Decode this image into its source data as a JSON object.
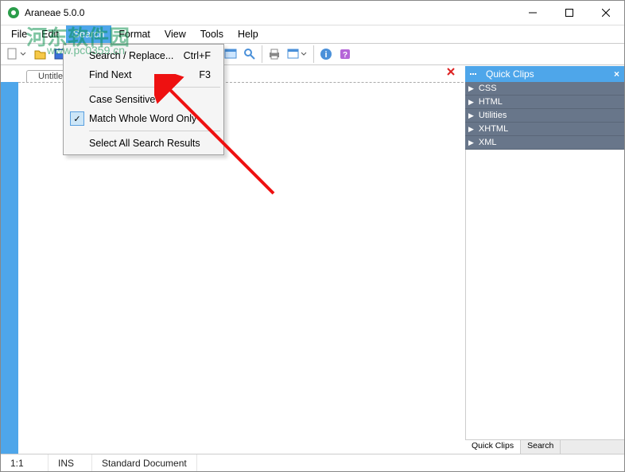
{
  "window": {
    "title": "Araneae 5.0.0"
  },
  "menubar": {
    "file": "File",
    "edit": "Edit",
    "search": "Search",
    "format": "Format",
    "view": "View",
    "tools": "Tools",
    "help": "Help"
  },
  "dropdown": {
    "search_replace": "Search / Replace...",
    "search_replace_key": "Ctrl+F",
    "find_next": "Find Next",
    "find_next_key": "F3",
    "case_sensitive": "Case Sensitive",
    "match_whole": "Match Whole Word Only",
    "select_all": "Select All Search Results"
  },
  "tab": {
    "name": "Untitle"
  },
  "side": {
    "title": "Quick Clips",
    "items": [
      "CSS",
      "HTML",
      "Utilities",
      "XHTML",
      "XML"
    ],
    "tab1": "Quick Clips",
    "tab2": "Search"
  },
  "status": {
    "pos": "1:1",
    "mode": "INS",
    "doc": "Standard Document"
  },
  "watermark": {
    "main": "河东软件园",
    "sub": "www.pc0359.cn"
  }
}
